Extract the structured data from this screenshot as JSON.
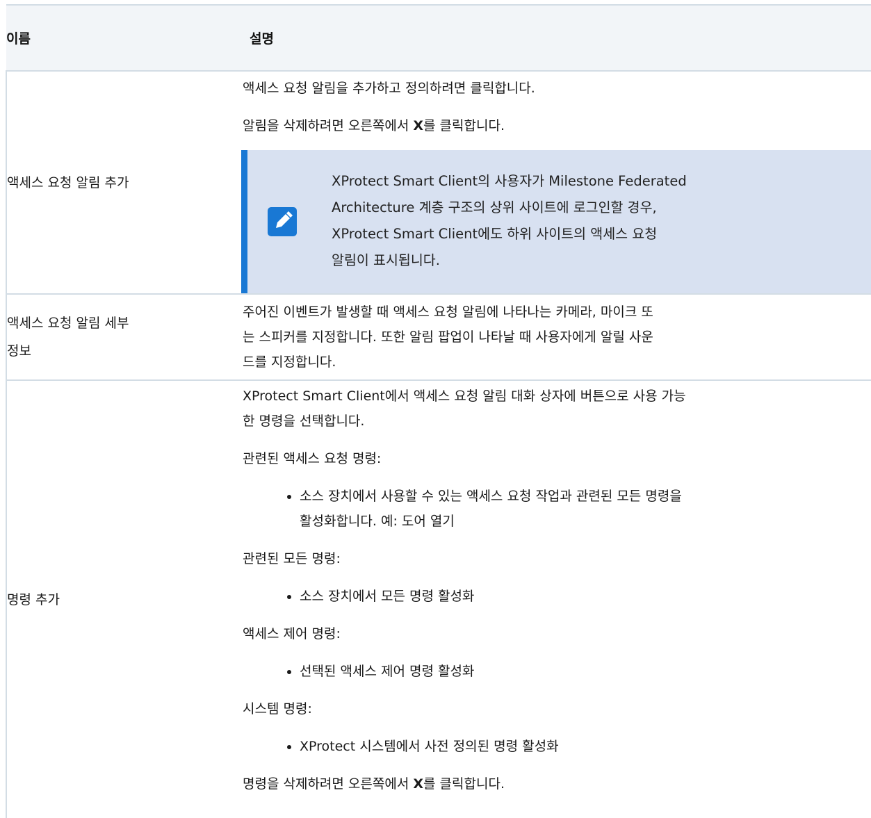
{
  "header": {
    "name": "이름",
    "description": "설명"
  },
  "rows": [
    {
      "name": "액세스 요청 알림 추가",
      "lines": [
        "액세스 요청 알림을 추가하고 정의하려면 클릭합니다.",
        {
          "before": "알림을 삭제하려면 오른쪽에서 ",
          "bold": "X",
          "after": "를 클릭합니다."
        }
      ],
      "note": {
        "icon": "pencil-icon",
        "text_lines": [
          "XProtect Smart Client의 사용자가 Milestone Federated",
          "Architecture 계층 구조의 상위 사이트에 로그인할 경우,",
          "XProtect Smart Client에도 하위 사이트의 액세스 요청",
          "알림이 표시됩니다."
        ]
      }
    },
    {
      "name_lines": [
        "액세스 요청 알림 세부",
        "정보"
      ],
      "text_lines": [
        "주어진 이벤트가 발생할 때 액세스 요청 알림에 나타나는 카메라, 마이크 또",
        "는 스피커를 지정합니다. 또한 알림 팝업이 나타날 때 사용자에게 알릴 사운",
        "드를 지정합니다."
      ]
    },
    {
      "name": "명령 추가",
      "intro_lines": [
        "XProtect Smart Client에서 액세스 요청 알림 대화 상자에 버튼으로 사용 가능",
        "한 명령을 선택합니다."
      ],
      "groups": [
        {
          "label": "관련된 액세스 요청 명령:",
          "bullet_lines": [
            "소스 장치에서 사용할 수 있는 액세스 요청 작업과 관련된 모든 명령을",
            "활성화합니다. 예: 도어 열기"
          ]
        },
        {
          "label": "관련된 모든 명령:",
          "bullet": "소스 장치에서 모든 명령 활성화"
        },
        {
          "label": "액세스 제어 명령:",
          "bullet": "선택된 액세스 제어 명령 활성화"
        },
        {
          "label": "시스템 명령:",
          "bullet": "XProtect 시스템에서 사전 정의된 명령 활성화"
        }
      ],
      "footer": {
        "before": "명령을 삭제하려면 오른쪽에서 ",
        "bold": "X",
        "after": "를 클릭합니다."
      }
    }
  ],
  "colors": {
    "header_bg": "#f2f5f8",
    "border": "#d3dde5",
    "note_bg": "#d8e1f1",
    "note_accent": "#1978d4"
  }
}
